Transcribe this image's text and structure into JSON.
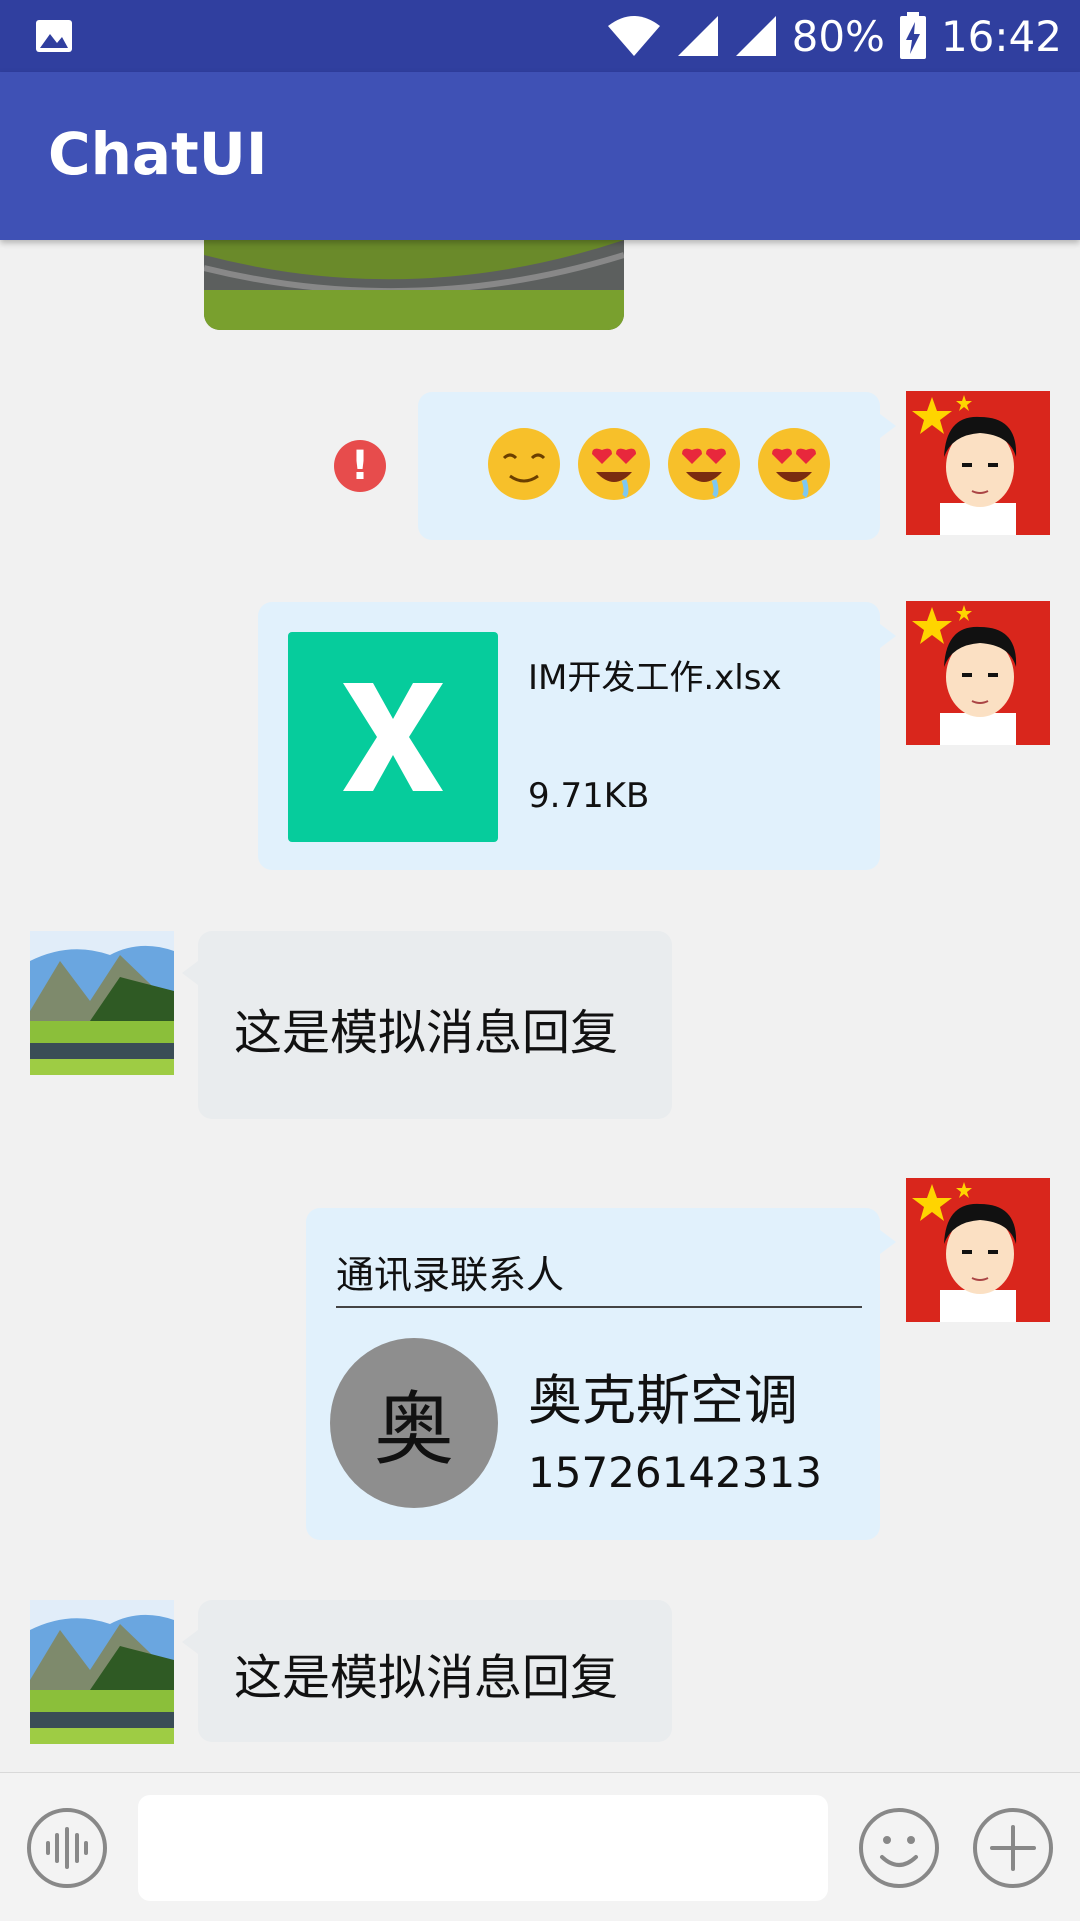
{
  "status_bar": {
    "battery": "80%",
    "time": "16:42",
    "icons": [
      "image-icon",
      "wifi-icon",
      "signal-icon",
      "signal-icon",
      "battery-charging-icon"
    ]
  },
  "app": {
    "title": "ChatUI"
  },
  "messages": {
    "emoji_msg": {
      "emojis": [
        "relieved-face",
        "drooling-heart-eyes",
        "drooling-heart-eyes",
        "drooling-heart-eyes"
      ],
      "failed": "!"
    },
    "file_msg": {
      "name": "IM开发工作.xlsx",
      "size": "9.71KB",
      "icon_letter": "X"
    },
    "reply_1": {
      "text": "这是模拟消息回复"
    },
    "contact_card": {
      "header": "通讯录联系人",
      "avatar_char": "奥",
      "name": "奥克斯空调",
      "phone": "15726142313"
    },
    "reply_2": {
      "text": "这是模拟消息回复"
    }
  },
  "input_bar": {
    "placeholder": "",
    "icons": [
      "voice-icon",
      "emoji-icon",
      "add-icon"
    ]
  },
  "colors": {
    "status_bar": "#303f9f",
    "app_bar": "#3f51b5",
    "bubble_me": "#e1f1fc",
    "bubble_other": "#e9ecee",
    "file_icon": "#06cc9c",
    "error": "#e74c4c"
  }
}
